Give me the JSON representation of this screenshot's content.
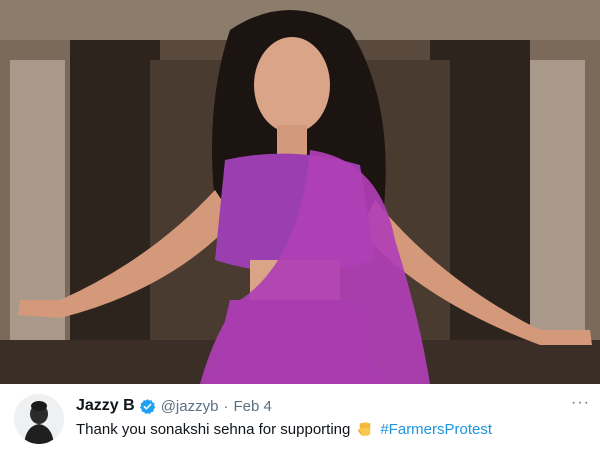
{
  "photo": {
    "subject": "woman-in-purple-saree"
  },
  "tweet": {
    "display_name": "Jazzy B",
    "handle": "@jazzyb",
    "separator": "·",
    "date": "Feb 4",
    "text": "Thank you sonakshi sehna for supporting",
    "emoji": "raised-fist",
    "hashtag": "#FarmersProtest",
    "more_label": "···",
    "link_color": "#1b95e0",
    "verified_color": "#1da1f2"
  }
}
